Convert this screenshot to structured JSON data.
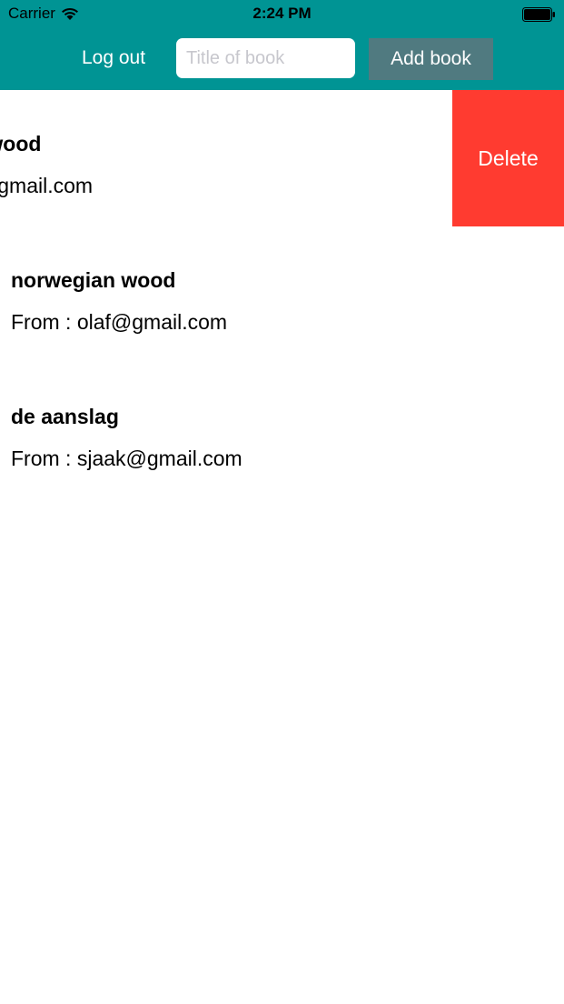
{
  "status_bar": {
    "carrier": "Carrier",
    "time": "2:24 PM"
  },
  "toolbar": {
    "logout_label": "Log out",
    "title_input_placeholder": "Title of book",
    "title_input_value": "",
    "add_book_label": "Add book"
  },
  "books": [
    {
      "title": "norwegian wood",
      "from": "From : olaf@gmail.com",
      "swiped": true,
      "delete_label": "Delete"
    },
    {
      "title": "norwegian wood",
      "from": "From : olaf@gmail.com",
      "swiped": false
    },
    {
      "title": "de aanslag",
      "from": "From : sjaak@gmail.com",
      "swiped": false
    }
  ],
  "colors": {
    "header_bg": "#009494",
    "add_button_bg": "#507a80",
    "delete_bg": "#ff3b30"
  }
}
